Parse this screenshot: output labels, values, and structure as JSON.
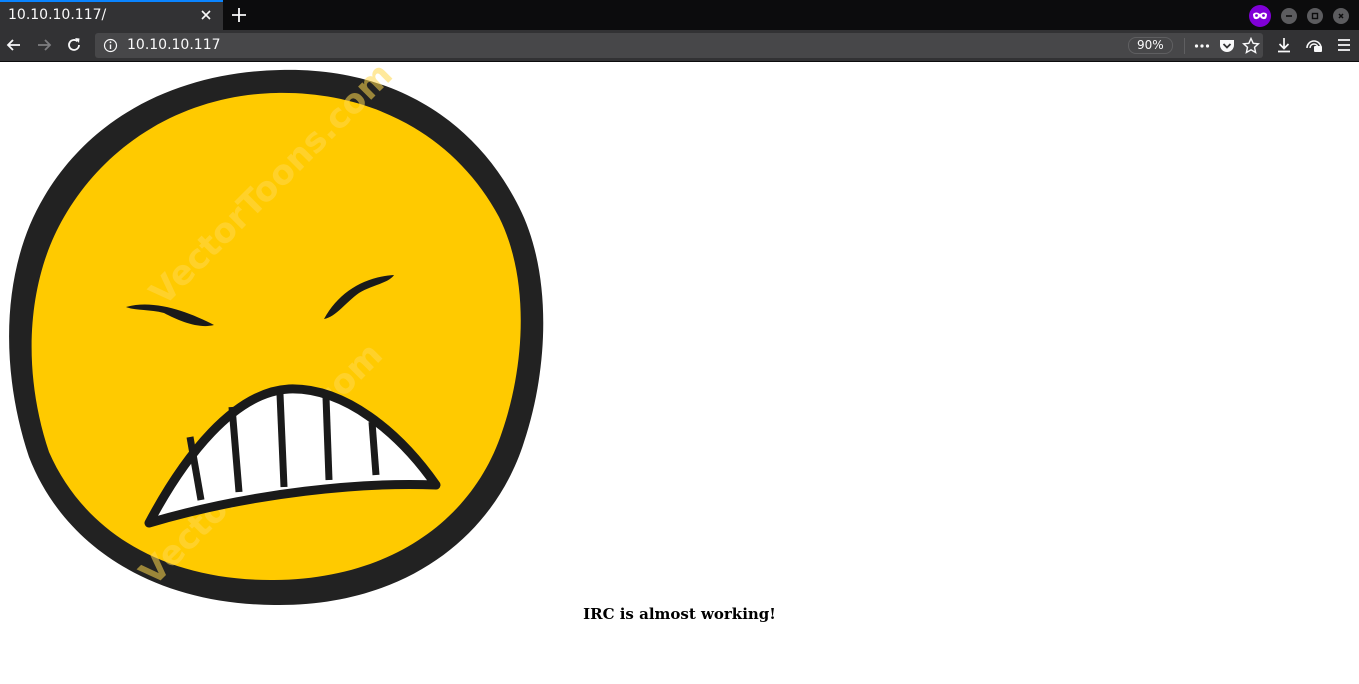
{
  "browser": {
    "tab_title": "10.10.10.117/",
    "url": "10.10.10.117",
    "zoom": "90%",
    "accent_color": "#0a84ff",
    "private_color": "#8000d7"
  },
  "page": {
    "message": "IRC is almost working!",
    "image": {
      "description_icon": "grimacing-emoji",
      "face_color": "#ffca00",
      "outline_color": "#222222",
      "watermark": "VectorToons.com"
    }
  }
}
